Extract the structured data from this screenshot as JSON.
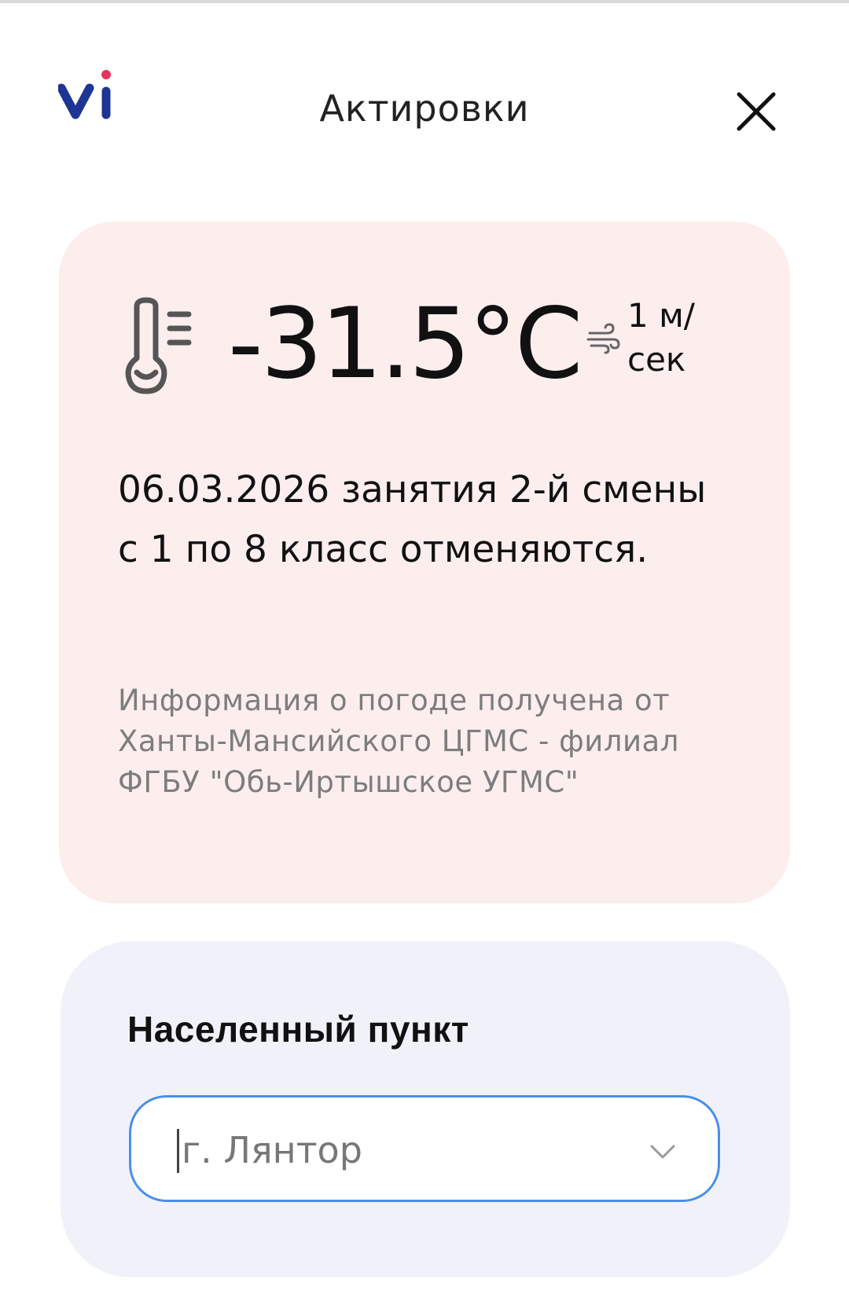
{
  "header": {
    "title": "Актировки",
    "logo_text": "vi",
    "logo_colors": {
      "primary": "#1f3594",
      "dot": "#e8335a"
    },
    "close_icon": "close-icon"
  },
  "weather": {
    "temperature": "-31.5°C",
    "wind_speed": "1 м/сек",
    "notice": "06.03.2026 занятия 2-й смены с 1 по 8 класс отменяются.",
    "source": "Информация о погоде получена от Ханты-Мансийского ЦГМС - филиал ФГБУ \"Обь-Иртышское УГМС\"",
    "card_color": "#fdeeee",
    "icons": {
      "temperature": "thermometer-icon",
      "wind": "wind-icon"
    }
  },
  "location": {
    "label": "Населенный пункт",
    "selected_value": "г. Лянтор",
    "card_color": "#f1f2f9",
    "accent_color": "#4a8fe8",
    "dropdown_icon": "chevron-down-icon"
  }
}
